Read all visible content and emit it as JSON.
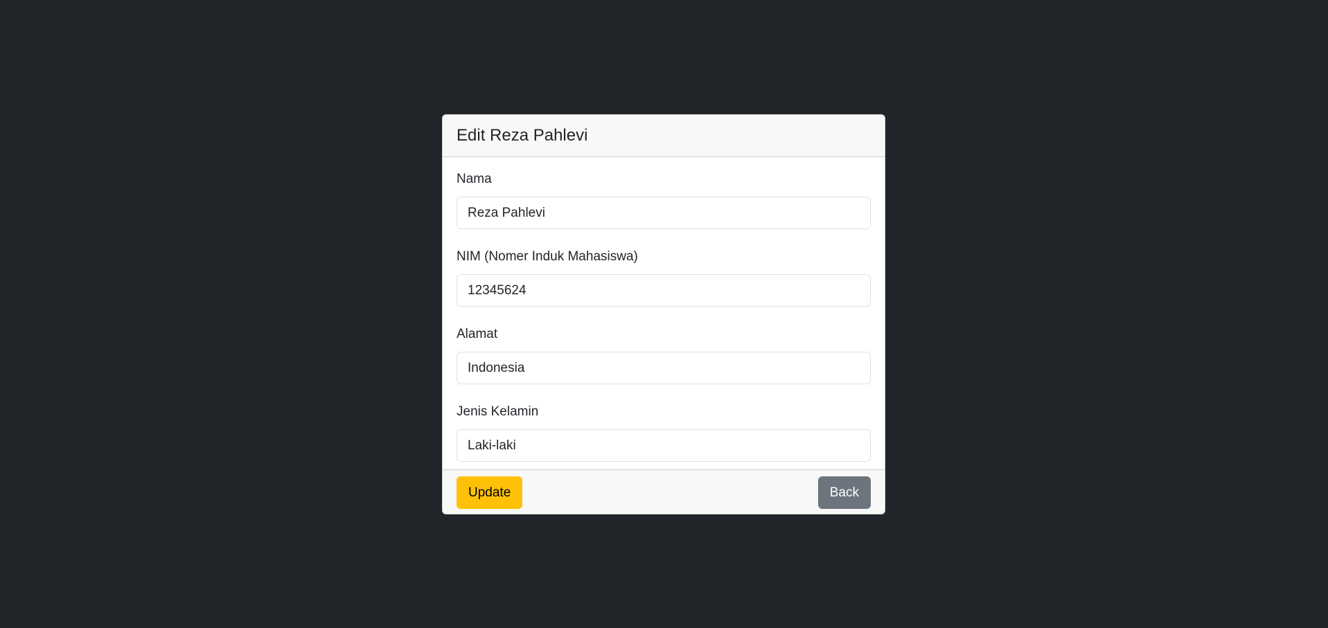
{
  "card": {
    "title": "Edit Reza Pahlevi"
  },
  "form": {
    "nama": {
      "label": "Nama",
      "value": "Reza Pahlevi"
    },
    "nim": {
      "label": "NIM (Nomer Induk Mahasiswa)",
      "value": "12345624"
    },
    "alamat": {
      "label": "Alamat",
      "value": "Indonesia"
    },
    "jenis_kelamin": {
      "label": "Jenis Kelamin",
      "value": "Laki-laki"
    }
  },
  "footer": {
    "update_label": "Update",
    "back_label": "Back"
  },
  "colors": {
    "background": "#212529",
    "warning": "#ffc107",
    "secondary": "#6c757d"
  }
}
